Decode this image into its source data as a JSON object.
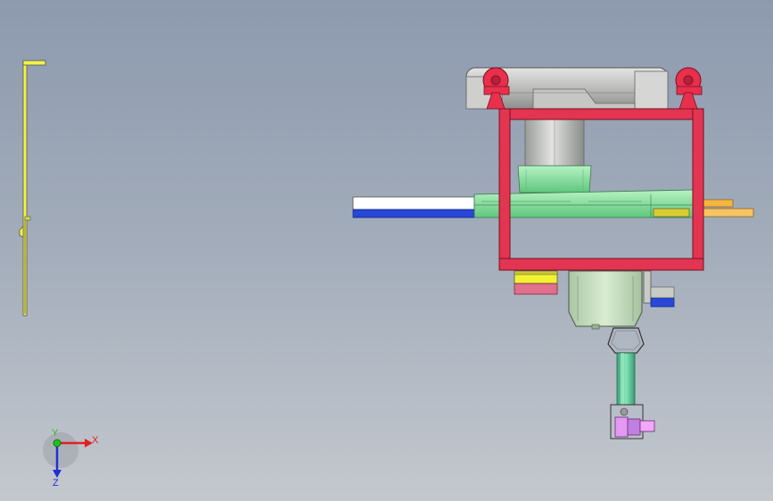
{
  "viewport": {
    "background_top": "#8d9aae",
    "background_bottom": "#c4c8ce"
  },
  "triad": {
    "x_label": "X",
    "y_label": "Y",
    "z_label": "Z",
    "x_color": "#e02020",
    "y_color": "#20c020",
    "z_color": "#2030d0"
  },
  "model": {
    "frame_color": "#e0304a",
    "rail_color": "#f0f040",
    "housing_color": "#c8ccc4",
    "column_color": "#cfd1cf",
    "table_color": "#7fe0a0",
    "motor_color": "#cde6c4"
  }
}
